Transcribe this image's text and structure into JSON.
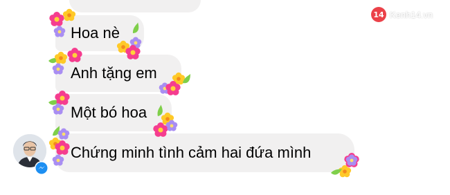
{
  "conversation": {
    "messages": [
      {
        "text": "Hoa nè"
      },
      {
        "text": "Anh tặng em"
      },
      {
        "text": "Một bó hoa"
      },
      {
        "text": "Chứng minh tình cảm hai đứa mình"
      }
    ],
    "sender": {
      "avatar_icon": "person-avatar",
      "badge_icon": "messenger-icon"
    }
  },
  "watermark": {
    "badge": "14",
    "text": "Kenh14.vn"
  },
  "colors": {
    "bubble": "#f1f0f0",
    "messenger_blue": "#1d8ff2",
    "logo_red": "#e8202a",
    "flower_pink": "#f53d8f",
    "flower_yellow": "#ffc928",
    "flower_purple": "#a98ef2",
    "leaf_green": "#7fcf4a"
  }
}
